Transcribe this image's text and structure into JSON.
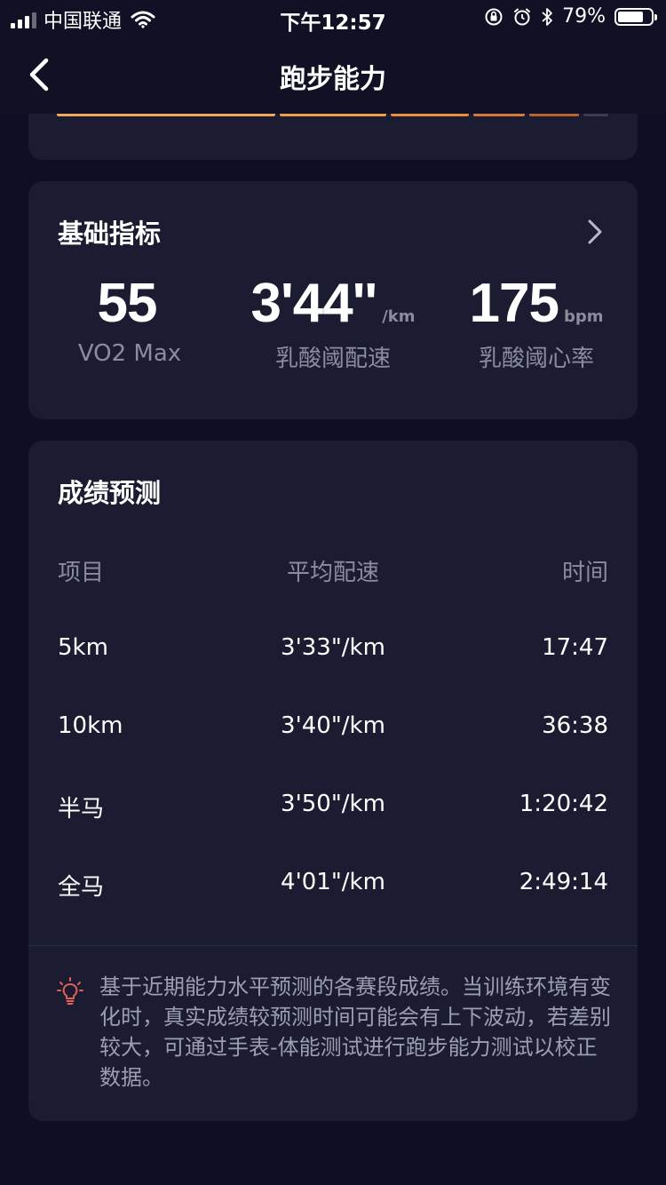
{
  "status_bar": {
    "carrier": "中国联通",
    "time": "下午12:57",
    "battery_percent": "79%",
    "battery_level": 0.79,
    "signal_bars": 3,
    "icons": [
      "signal-icon",
      "wifi-icon",
      "orientation-lock-icon",
      "alarm-icon",
      "bluetooth-icon",
      "battery-icon"
    ]
  },
  "nav": {
    "title": "跑步能力",
    "back_icon": "chevron-left-icon"
  },
  "zone_bar": {
    "segments": [
      {
        "color": "#f0a95a"
      },
      {
        "color": "#ee9c4c"
      },
      {
        "color": "#ec8d40"
      },
      {
        "color": "#d57a3a"
      },
      {
        "color": "#b8642c"
      },
      {
        "color": "#3a3b50"
      }
    ]
  },
  "basic": {
    "title": "基础指标",
    "chevron_icon": "chevron-right-icon",
    "metrics": [
      {
        "value": "55",
        "unit": "",
        "label": "VO2 Max"
      },
      {
        "value": "3'44''",
        "unit": "/km",
        "label": "乳酸阈配速"
      },
      {
        "value": "175",
        "unit": "bpm",
        "label": "乳酸阈心率"
      }
    ]
  },
  "prediction": {
    "title": "成绩预测",
    "headers": [
      "项目",
      "平均配速",
      "时间"
    ],
    "rows": [
      {
        "event": "5km",
        "pace": "3'33\"/km",
        "time": "17:47"
      },
      {
        "event": "10km",
        "pace": "3'40\"/km",
        "time": "36:38"
      },
      {
        "event": "半马",
        "pace": "3'50\"/km",
        "time": "1:20:42"
      },
      {
        "event": "全马",
        "pace": "4'01\"/km",
        "time": "2:49:14"
      }
    ],
    "note_icon": "lightbulb-icon",
    "note": "基于近期能力水平预测的各赛段成绩。当训练环境有变化时，真实成绩较预测时间可能会有上下波动，若差别较大，可通过手表-体能测试进行跑步能力测试以校正数据。"
  },
  "colors": {
    "background": "#0e0f24",
    "card": "#1b1c32",
    "secondary_text": "#8b8c9e",
    "note_icon": "#e0605a"
  }
}
